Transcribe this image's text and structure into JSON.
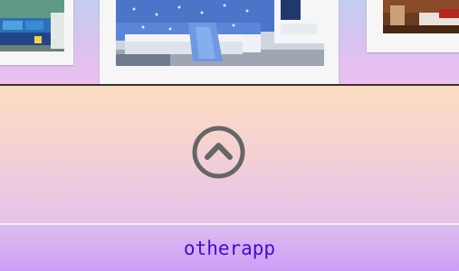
{
  "gallery": {
    "thumbnails": [
      {
        "icon": "kids-bed-photo"
      },
      {
        "icon": "blue-bedroom-photo"
      },
      {
        "icon": "wooden-bedroom-photo"
      }
    ]
  },
  "scroll_top": {
    "icon": "chevron-up-circle-icon",
    "color": "#666666"
  },
  "footer": {
    "link_text": "otherapp",
    "link_color": "#3d10cf"
  }
}
